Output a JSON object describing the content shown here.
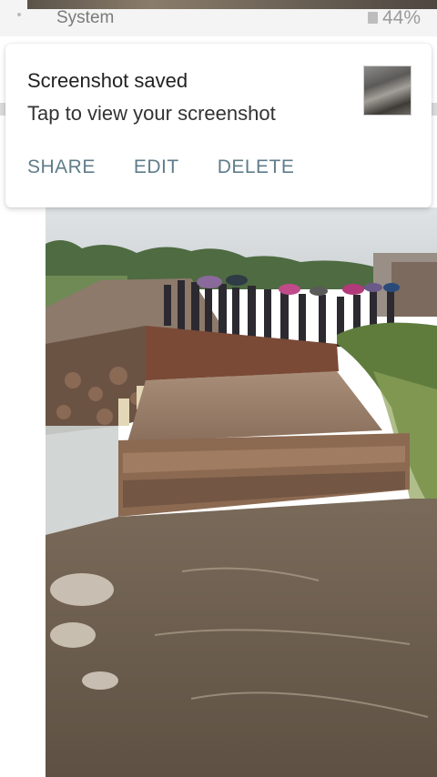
{
  "status_bar": {
    "app_label": "System",
    "battery_percent": "44%"
  },
  "notification": {
    "title": "Screenshot saved",
    "subtitle": "Tap to view your screenshot",
    "actions": [
      {
        "label": "SHARE"
      },
      {
        "label": "EDIT"
      },
      {
        "label": "DELETE"
      }
    ]
  }
}
